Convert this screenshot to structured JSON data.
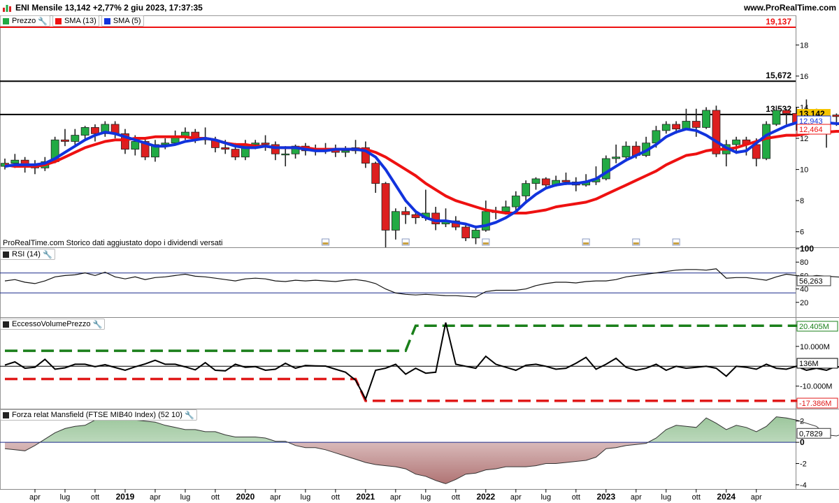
{
  "header": {
    "title": "ENI Mensile 13,142 +2,77% 2 giu 2023, 17:37:35",
    "site": "www.ProRealTime.com"
  },
  "notice": "ProRealTime.com  Storico dati aggiustato dopo i dividendi versati",
  "colors": {
    "up": "#22aa44",
    "down": "#dd1f1f",
    "sma13": "#ee1111",
    "sma5": "#1133dd",
    "dashGreen": "#1a7f1a",
    "dashRed": "#e01a1a"
  },
  "chart_data": [
    {
      "type": "candlestick",
      "panel": "price",
      "legend": [
        {
          "label": "Prezzo",
          "color": "#22aa44"
        },
        {
          "label": "SMA (13)",
          "color": "#ee1111"
        },
        {
          "label": "SMA (5)",
          "color": "#1133dd"
        }
      ],
      "ylim": [
        5,
        19.9
      ],
      "y_ticks": [
        "6",
        "8",
        "10",
        "12",
        "14",
        "16",
        "18"
      ],
      "levels": [
        {
          "value": 19.137,
          "label": "19,137",
          "color": "#ee1111"
        },
        {
          "value": 15.672,
          "label": "15,672",
          "color": "#000000"
        },
        {
          "value": 13.532,
          "label": "13,532",
          "color": "#000000"
        }
      ],
      "last_labels": [
        {
          "value": 13.142,
          "label": "13,142",
          "color": "#f5c400"
        },
        {
          "value": 12.943,
          "label": "12,943",
          "color": "#1133dd"
        },
        {
          "value": 12.464,
          "label": "12,464",
          "color": "#ee1111"
        }
      ],
      "start": "2018-01",
      "candles": [
        [
          10.2,
          10.4,
          10.7,
          10.0
        ],
        [
          10.4,
          10.6,
          11.0,
          10.1
        ],
        [
          10.6,
          10.3,
          10.8,
          9.8
        ],
        [
          10.3,
          10.1,
          10.6,
          9.7
        ],
        [
          10.1,
          10.5,
          10.8,
          9.9
        ],
        [
          10.5,
          11.9,
          12.1,
          10.4
        ],
        [
          11.9,
          11.8,
          12.6,
          11.5
        ],
        [
          11.8,
          12.2,
          12.6,
          11.6
        ],
        [
          12.2,
          12.7,
          12.8,
          11.9
        ],
        [
          12.7,
          12.3,
          12.9,
          11.8
        ],
        [
          12.3,
          12.9,
          13.1,
          12.1
        ],
        [
          12.9,
          12.3,
          13.1,
          12.0
        ],
        [
          12.3,
          11.3,
          12.6,
          11.0
        ],
        [
          11.3,
          11.8,
          12.2,
          10.9
        ],
        [
          11.8,
          10.8,
          12.0,
          10.6
        ],
        [
          10.8,
          11.6,
          11.9,
          10.5
        ],
        [
          11.6,
          11.7,
          12.0,
          11.3
        ],
        [
          11.7,
          12.1,
          12.5,
          11.6
        ],
        [
          12.1,
          12.4,
          12.7,
          11.9
        ],
        [
          12.4,
          12.0,
          12.6,
          11.7
        ],
        [
          12.0,
          11.9,
          12.7,
          11.6
        ],
        [
          11.9,
          11.4,
          12.1,
          11.1
        ],
        [
          11.4,
          11.3,
          11.9,
          11.0
        ],
        [
          11.3,
          10.8,
          11.7,
          10.6
        ],
        [
          10.8,
          11.6,
          11.9,
          10.6
        ],
        [
          11.6,
          11.7,
          11.9,
          11.3
        ],
        [
          11.7,
          11.6,
          12.2,
          11.2
        ],
        [
          11.6,
          11.0,
          11.8,
          10.6
        ],
        [
          11.0,
          11.0,
          11.5,
          10.2
        ],
        [
          11.0,
          11.5,
          11.6,
          10.7
        ],
        [
          11.5,
          11.2,
          11.7,
          10.9
        ],
        [
          11.2,
          11.3,
          11.6,
          10.9
        ],
        [
          11.3,
          11.3,
          11.7,
          11.0
        ],
        [
          11.3,
          11.1,
          11.6,
          10.8
        ],
        [
          11.1,
          11.2,
          11.5,
          10.8
        ],
        [
          11.2,
          11.4,
          11.9,
          11.0
        ],
        [
          11.4,
          10.4,
          11.8,
          10.1
        ],
        [
          10.4,
          9.1,
          10.5,
          8.5
        ],
        [
          9.1,
          6.1,
          9.2,
          5.0
        ],
        [
          6.1,
          7.3,
          7.5,
          5.5
        ],
        [
          7.3,
          7.1,
          7.6,
          6.5
        ],
        [
          7.1,
          6.9,
          7.4,
          6.5
        ],
        [
          6.9,
          7.2,
          8.7,
          6.7
        ],
        [
          7.2,
          6.5,
          7.6,
          6.1
        ],
        [
          6.5,
          6.7,
          7.5,
          6.3
        ],
        [
          6.7,
          6.3,
          7.0,
          6.1
        ],
        [
          6.3,
          5.6,
          6.5,
          5.4
        ],
        [
          5.6,
          6.1,
          6.4,
          5.2
        ],
        [
          6.1,
          7.3,
          8.0,
          6.0
        ],
        [
          7.3,
          7.3,
          7.6,
          6.8
        ],
        [
          7.3,
          7.6,
          8.0,
          7.1
        ],
        [
          7.6,
          8.3,
          8.6,
          7.3
        ],
        [
          8.3,
          9.1,
          9.3,
          7.8
        ],
        [
          9.1,
          9.4,
          9.5,
          8.7
        ],
        [
          9.4,
          9.0,
          9.5,
          8.8
        ],
        [
          9.0,
          9.3,
          9.6,
          8.9
        ],
        [
          9.3,
          9.2,
          9.8,
          9.0
        ],
        [
          9.2,
          9.0,
          9.5,
          8.6
        ],
        [
          9.0,
          9.2,
          9.7,
          8.9
        ],
        [
          9.2,
          9.4,
          10.2,
          9.0
        ],
        [
          9.4,
          10.7,
          10.9,
          9.3
        ],
        [
          10.7,
          10.8,
          11.6,
          10.4
        ],
        [
          10.8,
          11.5,
          11.8,
          10.5
        ],
        [
          11.5,
          10.9,
          11.8,
          10.7
        ],
        [
          10.9,
          11.7,
          12.1,
          10.8
        ],
        [
          11.7,
          12.5,
          12.8,
          11.4
        ],
        [
          12.5,
          12.9,
          13.1,
          12.3
        ],
        [
          12.9,
          12.6,
          13.1,
          12.3
        ],
        [
          12.6,
          13.1,
          13.9,
          12.7
        ],
        [
          13.1,
          12.7,
          13.9,
          12.1
        ],
        [
          12.7,
          13.8,
          14.0,
          12.6
        ],
        [
          13.8,
          11.0,
          14.1,
          10.8
        ],
        [
          11.0,
          11.6,
          11.9,
          10.2
        ],
        [
          11.6,
          11.9,
          12.1,
          11.0
        ],
        [
          11.9,
          11.6,
          12.1,
          10.9
        ],
        [
          11.6,
          10.7,
          12.0,
          10.2
        ],
        [
          10.7,
          12.9,
          13.1,
          10.6
        ],
        [
          12.9,
          13.8,
          14.1,
          12.8
        ],
        [
          13.8,
          13.6,
          13.9,
          12.9
        ],
        [
          13.6,
          13.0,
          14.0,
          12.5
        ],
        [
          13.0,
          13.8,
          14.5,
          12.9
        ],
        [
          13.8,
          12.8,
          13.9,
          12.5
        ],
        [
          12.8,
          13.5,
          13.8,
          11.4
        ],
        [
          13.5,
          13.4,
          13.6,
          12.8
        ],
        [
          13.4,
          12.6,
          13.8,
          12.4
        ],
        [
          12.6,
          13.14,
          13.2,
          12.5
        ]
      ],
      "sma13": [
        10.3,
        10.2,
        10.2,
        10.2,
        10.3,
        10.5,
        10.8,
        11.1,
        11.4,
        11.6,
        11.8,
        11.9,
        11.9,
        12.0,
        12.0,
        12.1,
        12.1,
        12.1,
        12.1,
        12.0,
        12.0,
        11.9,
        11.7,
        11.6,
        11.6,
        11.5,
        11.5,
        11.4,
        11.4,
        11.4,
        11.4,
        11.3,
        11.3,
        11.3,
        11.3,
        11.3,
        11.3,
        11.1,
        10.8,
        10.4,
        10.0,
        9.6,
        9.1,
        8.7,
        8.3,
        8.0,
        7.8,
        7.6,
        7.4,
        7.3,
        7.2,
        7.2,
        7.2,
        7.3,
        7.4,
        7.6,
        7.7,
        7.8,
        7.9,
        8.1,
        8.4,
        8.7,
        9.0,
        9.3,
        9.6,
        9.9,
        10.3,
        10.6,
        10.9,
        11.0,
        11.2,
        11.3,
        11.3,
        11.4,
        11.6,
        11.8,
        12.0,
        12.1,
        12.2,
        12.2,
        12.3,
        12.4,
        12.4,
        12.45,
        12.46
      ],
      "sma5": [
        10.2,
        10.3,
        10.3,
        10.3,
        10.4,
        10.7,
        11.1,
        11.5,
        11.9,
        12.2,
        12.4,
        12.3,
        12.1,
        11.9,
        11.7,
        11.5,
        11.5,
        11.6,
        11.8,
        11.9,
        12.0,
        11.9,
        11.7,
        11.5,
        11.4,
        11.4,
        11.5,
        11.4,
        11.4,
        11.4,
        11.3,
        11.2,
        11.2,
        11.3,
        11.3,
        11.3,
        11.2,
        10.8,
        10.0,
        9.0,
        8.0,
        7.3,
        6.9,
        6.7,
        6.7,
        6.6,
        6.5,
        6.3,
        6.4,
        6.6,
        6.9,
        7.3,
        7.9,
        8.4,
        8.8,
        9.0,
        9.1,
        9.1,
        9.2,
        9.4,
        9.8,
        10.2,
        10.6,
        10.9,
        11.2,
        11.6,
        12.1,
        12.4,
        12.6,
        12.5,
        12.2,
        11.8,
        11.4,
        11.1,
        11.2,
        11.7,
        12.2,
        12.5,
        12.8,
        13.0,
        13.1,
        13.1,
        13.0,
        12.95,
        12.94
      ]
    },
    {
      "type": "line",
      "panel": "rsi",
      "legend": [
        {
          "label": "RSI (14)",
          "color": "#000000"
        }
      ],
      "ylim": [
        0,
        100
      ],
      "y_ticks": [
        "100",
        "80",
        "60",
        "40",
        "20"
      ],
      "bands": [
        70,
        30
      ],
      "last_label": "56,263",
      "values": [
        52,
        54,
        50,
        48,
        52,
        58,
        60,
        61,
        64,
        60,
        65,
        58,
        55,
        58,
        54,
        57,
        58,
        60,
        62,
        59,
        58,
        56,
        54,
        52,
        55,
        56,
        55,
        52,
        51,
        53,
        52,
        53,
        52,
        51,
        53,
        54,
        52,
        48,
        40,
        34,
        32,
        31,
        32,
        31,
        30,
        30,
        29,
        28,
        36,
        38,
        38,
        38,
        40,
        45,
        48,
        50,
        50,
        49,
        51,
        52,
        52,
        54,
        58,
        60,
        62,
        64,
        66,
        68,
        69,
        69,
        68,
        70,
        56,
        57,
        57,
        55,
        53,
        58,
        62,
        60,
        58,
        60,
        59,
        58,
        57,
        59,
        56
      ]
    },
    {
      "type": "line",
      "panel": "eccesso",
      "legend": [
        {
          "label": "EccessoVolumePrezzo",
          "color": "#000000"
        }
      ],
      "ylim": [
        -21000000,
        24000000
      ],
      "y_ticks": [
        "10.000M",
        "0",
        "-10.000M"
      ],
      "last_labels": [
        {
          "label": "20.405M",
          "color": "#1a7f1a"
        },
        {
          "label": "136M",
          "color": "#000000"
        },
        {
          "label": "-17.386M",
          "color": "#e01a1a"
        }
      ],
      "upper_dash": {
        "before": 7800000,
        "after": 20405000,
        "from": 0,
        "break": 41,
        "to": 82
      },
      "lower_dash": {
        "before": -6400000,
        "after": -17386000,
        "from": 0,
        "break": 36,
        "to": 82
      },
      "values": [
        600000,
        2200000,
        -1000000,
        -500000,
        3500000,
        -1500000,
        -800000,
        1000000,
        1000000,
        -200000,
        800000,
        -600000,
        -2000000,
        -300000,
        1200000,
        3000000,
        1000000,
        1000000,
        -300000,
        -1800000,
        1800000,
        -2000000,
        -2300000,
        1000000,
        -500000,
        -200000,
        -2000000,
        -1500000,
        1500000,
        -1000000,
        400000,
        200000,
        100000,
        -1500000,
        -3000000,
        -7000000,
        -16500000,
        -2000000,
        -1000000,
        1000000,
        -4000000,
        -1000000,
        -3500000,
        -3000000,
        22000000,
        1000000,
        0,
        -1000000,
        5000000,
        1000000,
        -500000,
        -2000000,
        500000,
        1000000,
        0,
        -1500000,
        -1000000,
        1500000,
        4500000,
        -1500000,
        1000000,
        4000000,
        -500000,
        -2000000,
        -1000000,
        1000000,
        -2000000,
        0,
        -1000000,
        -500000,
        0,
        -1000000,
        -5000000,
        0,
        -500000,
        -1500000,
        1000000,
        -1000000,
        -1500000,
        0,
        -2000000,
        -1000000,
        -2000000,
        0,
        -1500000,
        136000
      ]
    },
    {
      "type": "area",
      "panel": "mansfield",
      "legend": [
        {
          "label": "Forza relat Mansfield (FTSE MIB40 Index) (52 10)",
          "color": "#000000"
        }
      ],
      "ylim": [
        -4.4,
        3.1
      ],
      "y_ticks": [
        "2",
        "0",
        "-2",
        "-4"
      ],
      "last_label": "0,7829",
      "values": [
        -0.6,
        -0.7,
        -0.8,
        -0.3,
        0.3,
        0.9,
        1.3,
        1.5,
        1.6,
        2.1,
        2.4,
        2.6,
        2.1,
        2.1,
        2.0,
        1.9,
        1.6,
        1.4,
        1.2,
        1.2,
        1.0,
        1.0,
        0.7,
        0.5,
        0.5,
        0.5,
        0.4,
        0.1,
        0.1,
        -0.3,
        -0.5,
        -0.5,
        -0.7,
        -1.0,
        -1.3,
        -1.6,
        -1.9,
        -2.1,
        -2.2,
        -2.3,
        -2.5,
        -3.0,
        -3.2,
        -3.6,
        -3.9,
        -3.5,
        -3.0,
        -2.9,
        -2.6,
        -2.5,
        -2.3,
        -2.3,
        -2.3,
        -2.2,
        -2.0,
        -2.0,
        -1.9,
        -1.8,
        -1.7,
        -1.4,
        -0.6,
        -0.5,
        -0.3,
        -0.2,
        -0.1,
        0.4,
        1.2,
        1.6,
        1.5,
        1.4,
        2.3,
        1.8,
        1.2,
        1.6,
        1.4,
        1.0,
        1.5,
        2.4,
        2.3,
        2.1,
        1.8,
        1.5,
        0.7,
        0.6,
        0.9,
        1.3,
        0.9,
        0.78
      ]
    }
  ],
  "x_axis": {
    "labels": [
      {
        "label": "apr",
        "m": 3
      },
      {
        "label": "lug",
        "m": 6
      },
      {
        "label": "ott",
        "m": 9
      },
      {
        "label": "2019",
        "m": 12,
        "bold": true
      },
      {
        "label": "apr",
        "m": 15
      },
      {
        "label": "lug",
        "m": 18
      },
      {
        "label": "ott",
        "m": 21
      },
      {
        "label": "2020",
        "m": 24,
        "bold": true
      },
      {
        "label": "apr",
        "m": 27
      },
      {
        "label": "lug",
        "m": 30
      },
      {
        "label": "ott",
        "m": 33
      },
      {
        "label": "2021",
        "m": 36,
        "bold": true
      },
      {
        "label": "apr",
        "m": 39
      },
      {
        "label": "lug",
        "m": 42
      },
      {
        "label": "ott",
        "m": 45
      },
      {
        "label": "2022",
        "m": 48,
        "bold": true
      },
      {
        "label": "apr",
        "m": 51
      },
      {
        "label": "lug",
        "m": 54
      },
      {
        "label": "ott",
        "m": 57
      },
      {
        "label": "2023",
        "m": 60,
        "bold": true
      },
      {
        "label": "apr",
        "m": 63
      },
      {
        "label": "lug",
        "m": 66
      },
      {
        "label": "ott",
        "m": 69
      },
      {
        "label": "2024",
        "m": 72,
        "bold": true
      },
      {
        "label": "apr",
        "m": 75
      }
    ]
  }
}
